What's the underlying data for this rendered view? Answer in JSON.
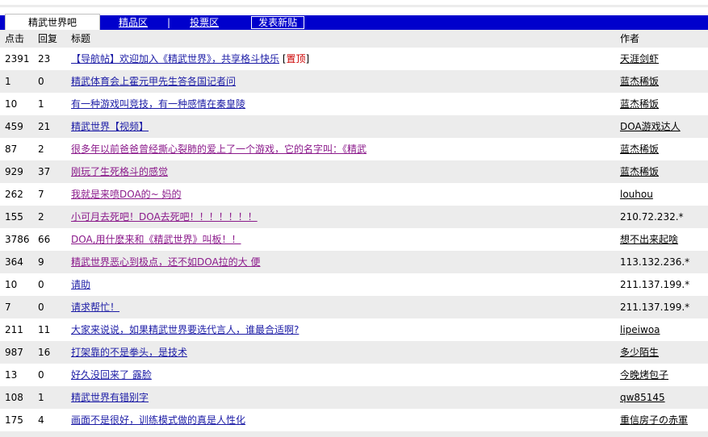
{
  "tabs": {
    "active": "精武世界吧",
    "featured": "精品区",
    "separator": "|",
    "vote": "投票区",
    "new_post": "发表新贴"
  },
  "columns": {
    "clicks": "点击",
    "replies": "回复",
    "title": "标题",
    "author": "作者"
  },
  "threads": [
    {
      "clicks": "2391",
      "replies": "23",
      "title": "【导航帖】欢迎加入《精武世界》，共享格斗快乐",
      "pin_open": "[",
      "pin": "置顶",
      "pin_close": "]",
      "author": "天涯剑虾",
      "visited": false,
      "author_link": true
    },
    {
      "clicks": "1",
      "replies": "0",
      "title": "精武体育会上霍元甲先生答各国记者问",
      "author": "蓝杰稀饭",
      "visited": false,
      "author_link": true
    },
    {
      "clicks": "10",
      "replies": "1",
      "title": "有一种游戏叫竞技，有一种感情在秦皇陵",
      "author": "蓝杰稀饭",
      "visited": false,
      "author_link": true
    },
    {
      "clicks": "459",
      "replies": "21",
      "title": "精武世界【视频】",
      "author": "DOA游戏达人",
      "visited": false,
      "author_link": true
    },
    {
      "clicks": "87",
      "replies": "2",
      "title": "很多年以前爸爸曾经撕心裂肺的爱上了一个游戏，它的名字叫：《精武",
      "author": "蓝杰稀饭",
      "visited": true,
      "author_link": true
    },
    {
      "clicks": "929",
      "replies": "37",
      "title": "刚玩了生死格斗的感觉",
      "author": "蓝杰稀饭",
      "visited": true,
      "author_link": true
    },
    {
      "clicks": "262",
      "replies": "7",
      "title": "我就是来喷DOA的~ 妈的",
      "author": "louhou",
      "visited": true,
      "author_link": true
    },
    {
      "clicks": "155",
      "replies": "2",
      "title": "小可月去死吧！DOA去死吧！！！！！！！",
      "author": "210.72.232.*",
      "visited": true,
      "author_link": false
    },
    {
      "clicks": "3786",
      "replies": "66",
      "title": "DOA,用什麽来和《精武世界》叫板！！",
      "author": "想不出来起啥",
      "visited": true,
      "author_link": true
    },
    {
      "clicks": "364",
      "replies": "9",
      "title": "精武世界恶心到极点，还不如DOA拉的大 便",
      "author": "113.132.236.*",
      "visited": true,
      "author_link": false
    },
    {
      "clicks": "10",
      "replies": "0",
      "title": "请助",
      "author": "211.137.199.*",
      "visited": false,
      "author_link": false
    },
    {
      "clicks": "7",
      "replies": "0",
      "title": "请求帮忙！",
      "author": "211.137.199.*",
      "visited": false,
      "author_link": false
    },
    {
      "clicks": "211",
      "replies": "11",
      "title": "大家来说说，如果精武世界要选代言人，谁最合适啊?",
      "author": "lipeiwoa",
      "visited": false,
      "author_link": true
    },
    {
      "clicks": "987",
      "replies": "16",
      "title": "打架靠的不是拳头，是技术",
      "author": "多少陌生",
      "visited": false,
      "author_link": true
    },
    {
      "clicks": "13",
      "replies": "0",
      "title": "好久没回来了 露脸",
      "author": "今晚烤包子",
      "visited": false,
      "author_link": true
    },
    {
      "clicks": "108",
      "replies": "1",
      "title": "精武世界有错别字",
      "author": "qw85145",
      "visited": false,
      "author_link": true
    },
    {
      "clicks": "175",
      "replies": "4",
      "title": "画面不是很好，训练模式做的真是人性化",
      "author": "重信房子の赤軍",
      "visited": false,
      "author_link": true
    }
  ],
  "colors": {
    "tabbar": "#0000cc",
    "row_alt": "#ececec",
    "link_unread": "#1c1ca6",
    "link_visited": "#8b1a8b",
    "pin": "#cc0000"
  }
}
